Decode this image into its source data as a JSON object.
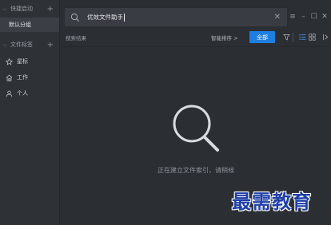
{
  "sidebar": {
    "quick_launch": {
      "label": "快捷启动",
      "expanded": true,
      "add": "+"
    },
    "default_group": "默认分组",
    "file_tags": {
      "label": "文件标签",
      "expanded": true,
      "add": "+"
    },
    "tags": [
      {
        "label": "星标",
        "icon": "star-icon"
      },
      {
        "label": "工作",
        "icon": "home-icon"
      },
      {
        "label": "个人",
        "icon": "person-icon"
      }
    ]
  },
  "search": {
    "query": "优效文件助手",
    "clear": "✕"
  },
  "window_controls": {
    "menu": "≡",
    "minimize": "–",
    "maximize": "☐",
    "close": "✕"
  },
  "toolbar": {
    "results_label": "搜索结果",
    "sort_label": "智能排序 >",
    "all_button": "全部",
    "icons": [
      "filter-icon",
      "list-view-icon",
      "grid-view-icon",
      "collapse-panel-icon"
    ]
  },
  "status_text": "正在建立文件索引，请稍候",
  "watermark": "最需教育",
  "colors": {
    "accent": "#1f7fe0",
    "background": "#2b2e33",
    "sidebar": "#2e3136"
  }
}
